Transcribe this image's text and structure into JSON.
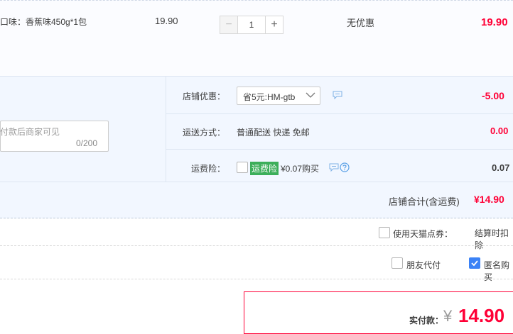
{
  "item": {
    "title": "口味：香蕉味450g*1包",
    "unit_price": "19.90",
    "quantity": "1",
    "qty_minus": "−",
    "qty_plus": "+",
    "promotion": "无优惠",
    "subtotal": "19.90"
  },
  "message": {
    "placeholder": "付款后商家可见",
    "counter": "0/200"
  },
  "shop_discount": {
    "label": "店铺优惠：",
    "selected": "省5元:HM-gtb",
    "amount": "-5.00"
  },
  "shipping": {
    "label": "运送方式：",
    "value": "普通配送 快递 免邮",
    "amount": "0.00"
  },
  "freight_insurance": {
    "label": "运费险：",
    "badge": "运费险",
    "price_text": "¥0.07购买",
    "amount": "0.07"
  },
  "shop_total": {
    "label": "店铺合计(含运费)",
    "amount": "¥14.90"
  },
  "tmall_points": {
    "label": "使用天猫点券：",
    "note": "结算时扣除"
  },
  "friend_pay": {
    "label": "朋友代付"
  },
  "anonymous": {
    "label": "匿名购买"
  },
  "payment": {
    "label": "实付款：",
    "currency": "¥",
    "amount": "14.90"
  },
  "colors": {
    "accent_red": "#ff0036",
    "panel_blue": "#f2f7ff",
    "badge_green": "#3cae5a",
    "checkbox_blue": "#3b82f6"
  },
  "icons": [
    "chevron-down-icon",
    "message-icon",
    "help-icon",
    "check-icon"
  ]
}
